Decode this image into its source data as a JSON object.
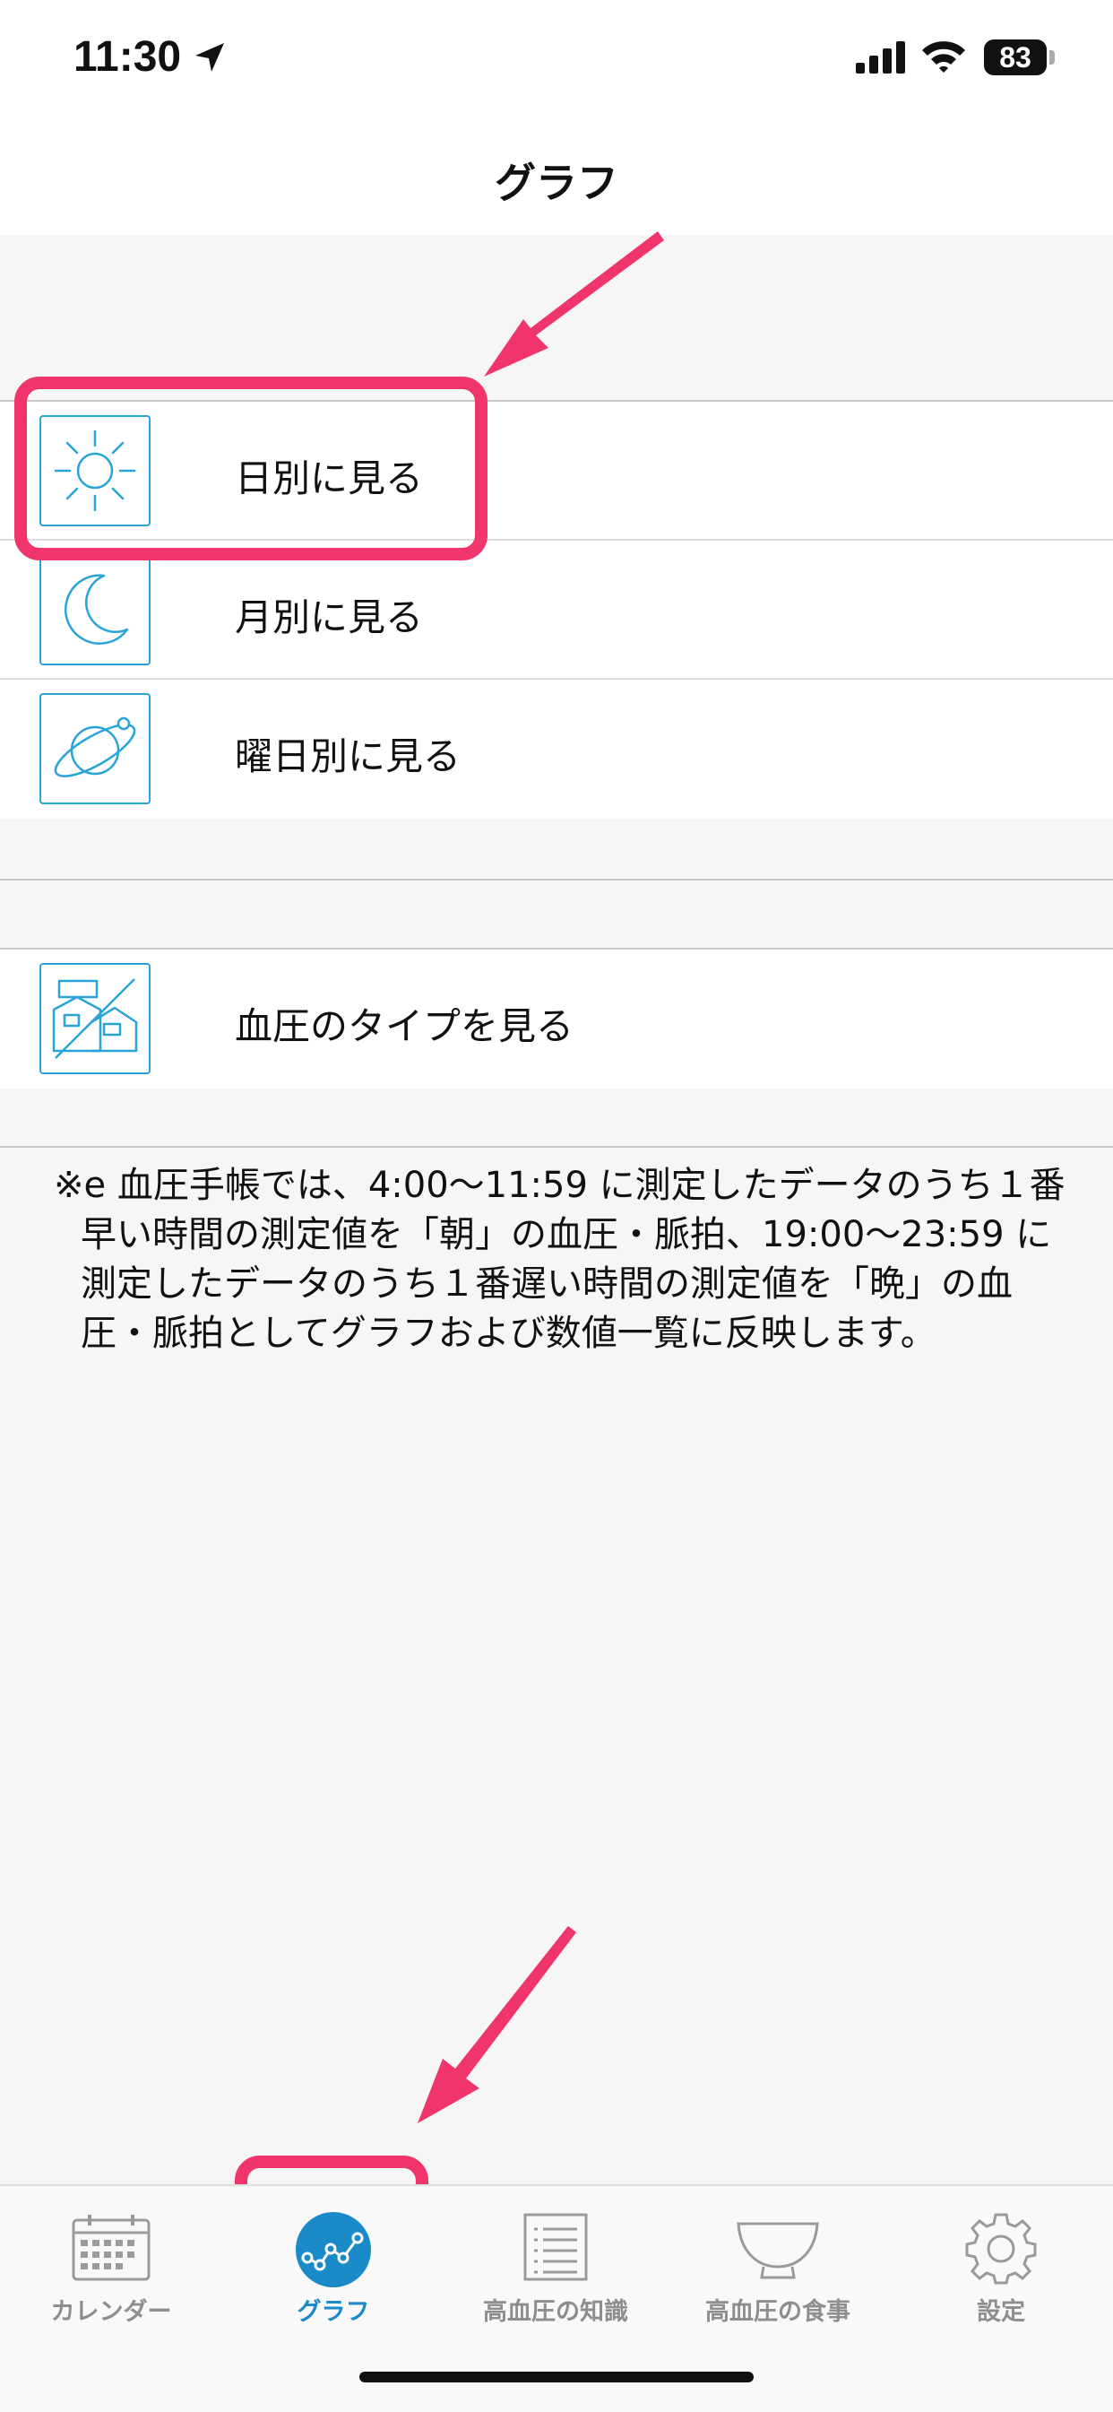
{
  "status_bar": {
    "time": "11:30",
    "battery": "83"
  },
  "nav": {
    "title": "グラフ"
  },
  "menu": {
    "group1": [
      {
        "label": "日別に見る",
        "icon": "sun-icon"
      },
      {
        "label": "月別に見る",
        "icon": "moon-icon"
      },
      {
        "label": "曜日別に見る",
        "icon": "planet-icon"
      }
    ],
    "group2": [
      {
        "label": "血圧のタイプを見る",
        "icon": "house-icon"
      }
    ]
  },
  "note": {
    "line1": "※e 血圧手帳では、4:00〜11:59 に測定したデータのうち１番早い時間の測定値を「朝」の血圧・脈拍、19:00〜23:59 に測定したデータのうち１番遅い時間の測定値を「晩」の血圧・脈拍としてグラフおよび数値一覧に反映します。"
  },
  "tabs": [
    {
      "label": "カレンダー",
      "icon": "calendar-icon",
      "active": false
    },
    {
      "label": "グラフ",
      "icon": "graph-icon",
      "active": true
    },
    {
      "label": "高血圧の知識",
      "icon": "list-icon",
      "active": false
    },
    {
      "label": "高血圧の食事",
      "icon": "bowl-icon",
      "active": false
    },
    {
      "label": "設定",
      "icon": "gear-icon",
      "active": false
    }
  ],
  "colors": {
    "accent": "#29a4d9",
    "tab_active": "#1a8ac9",
    "annotation": "#f0346c"
  }
}
